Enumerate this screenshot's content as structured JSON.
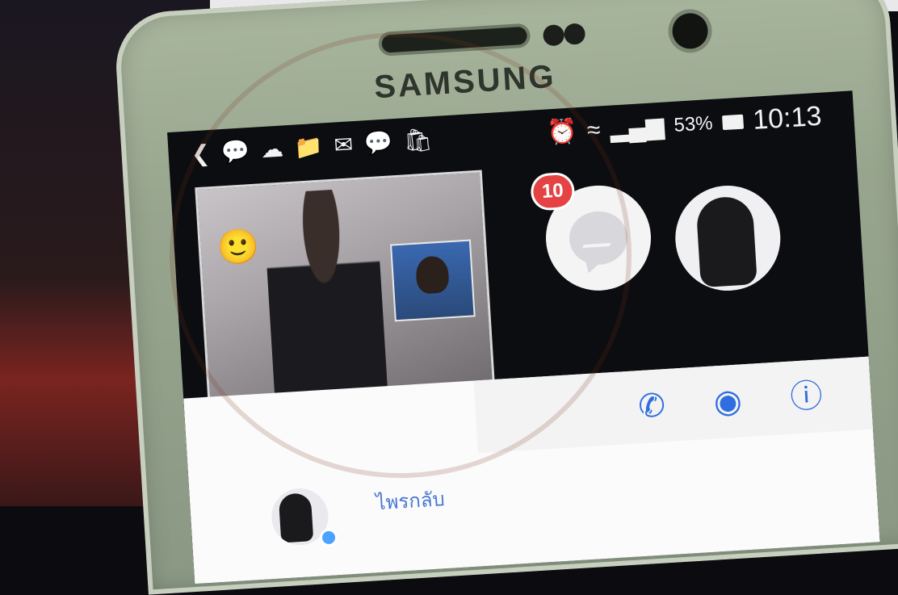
{
  "device": {
    "brand": "SAMSUNG"
  },
  "status_bar": {
    "back_icon": "chevron-left-icon",
    "notification_icons": [
      "chat-bubble-icon",
      "cloud-icon",
      "folder-icon",
      "mail-icon",
      "chat-bubble-icon",
      "bag-icon"
    ],
    "alarm_icon": "alarm-icon",
    "wifi_icon": "wifi-icon",
    "signal_icon": "signal-icon",
    "battery_percent": "53%",
    "time": "10:13"
  },
  "chat_heads": {
    "unread_badge": "10",
    "messenger_icon": "messenger-icon",
    "avatar_icon": "default-avatar-icon"
  },
  "chat_panel": {
    "call_icon": "phone-call-icon",
    "video_icon": "video-icon",
    "info_icon": "info-icon",
    "contact_name": "ไพรกลับ"
  },
  "colors": {
    "badge": "#e54343",
    "action_blue": "#2f6de0",
    "phone_body": "#a9b69e"
  }
}
